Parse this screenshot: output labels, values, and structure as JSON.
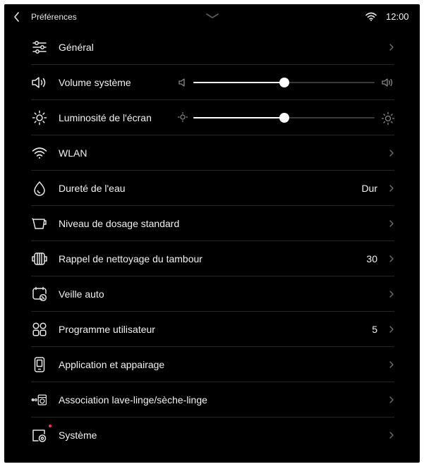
{
  "header": {
    "title": "Préférences",
    "time": "12:00",
    "icons": {
      "back": "chevron-left-icon",
      "pull": "chevron-down-icon",
      "wifi": "wifi-icon"
    }
  },
  "items": [
    {
      "id": "general",
      "icon": "sliders-icon",
      "label": "Général",
      "value": "",
      "chevron": true
    },
    {
      "id": "volume",
      "icon": "speaker-icon",
      "label": "Volume système",
      "slider": {
        "level": 0.5
      }
    },
    {
      "id": "brightness",
      "icon": "sun-icon",
      "label": "Luminosité de l'écran",
      "slider": {
        "level": 0.5
      }
    },
    {
      "id": "wlan",
      "icon": "wifi-icon",
      "label": "WLAN",
      "value": "",
      "chevron": true
    },
    {
      "id": "water-hardness",
      "icon": "water-drop-icon",
      "label": "Dureté de l'eau",
      "value": "Dur",
      "chevron": true
    },
    {
      "id": "dosage",
      "icon": "dosing-cup-icon",
      "label": "Niveau de dosage standard",
      "value": "",
      "chevron": true
    },
    {
      "id": "drum-cleaning",
      "icon": "drum-icon",
      "label": "Rappel de nettoyage du tambour",
      "value": "30",
      "chevron": true
    },
    {
      "id": "auto-standby",
      "icon": "standby-timer-icon",
      "label": "Veille auto",
      "value": "",
      "chevron": true
    },
    {
      "id": "user-program",
      "icon": "grid-icon",
      "label": "Programme utilisateur",
      "value": "5",
      "chevron": true
    },
    {
      "id": "app-pairing",
      "icon": "phone-icon",
      "label": "Application et appairage",
      "value": "",
      "chevron": true
    },
    {
      "id": "washer-dryer",
      "icon": "link-washer-icon",
      "label": "Association lave-linge/sèche-linge",
      "value": "",
      "chevron": true
    },
    {
      "id": "system",
      "icon": "system-settings-icon",
      "label": "Système",
      "value": "",
      "chevron": true,
      "notification_dot": true
    }
  ],
  "colors": {
    "background": "#000000",
    "text": "#f2f2f2",
    "divider": "#262626",
    "slider_fill": "#ffffff",
    "slider_track": "#3a3a3a",
    "notification": "#ff2d55"
  }
}
